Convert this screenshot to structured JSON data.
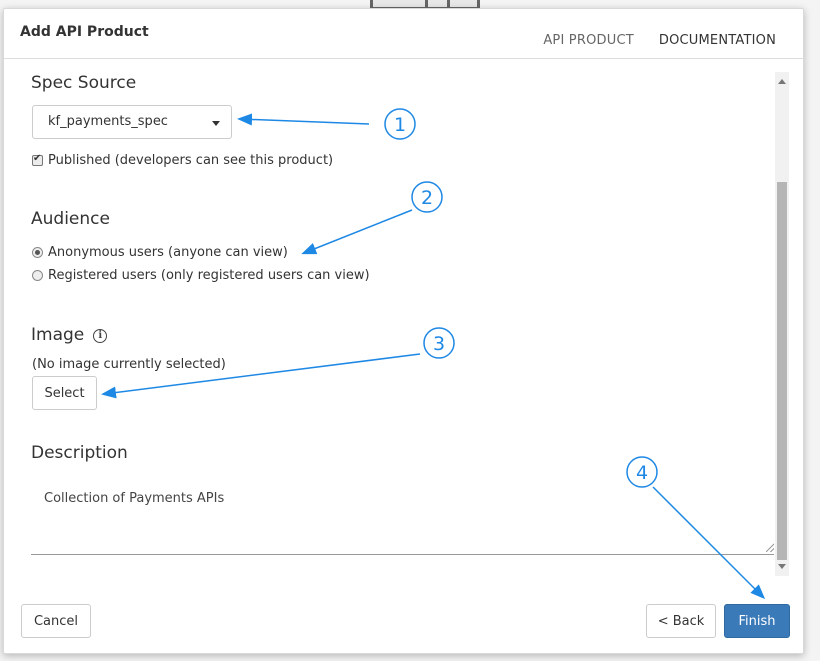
{
  "dialog": {
    "title": "Add API Product",
    "tabs": [
      {
        "label": "API PRODUCT",
        "active": false
      },
      {
        "label": "DOCUMENTATION",
        "active": true
      }
    ]
  },
  "spec_source": {
    "heading": "Spec Source",
    "selected": "kf_payments_spec"
  },
  "published": {
    "label": "Published (developers can see this product)",
    "checked": true
  },
  "audience": {
    "heading": "Audience",
    "options": [
      {
        "label": "Anonymous users (anyone can view)",
        "checked": true
      },
      {
        "label": "Registered users (only registered users can view)",
        "checked": false
      }
    ]
  },
  "image": {
    "heading": "Image",
    "icon": "info-icon",
    "status": "(No image currently selected)",
    "select_label": "Select"
  },
  "description": {
    "heading": "Description",
    "value": "Collection of Payments APIs"
  },
  "footer": {
    "cancel_label": "Cancel",
    "back_label": "< Back",
    "finish_label": "Finish"
  },
  "callouts": [
    "1",
    "2",
    "3",
    "4"
  ],
  "colors": {
    "accent": "#1e88e5",
    "primary_button": "#3a7ab8"
  }
}
